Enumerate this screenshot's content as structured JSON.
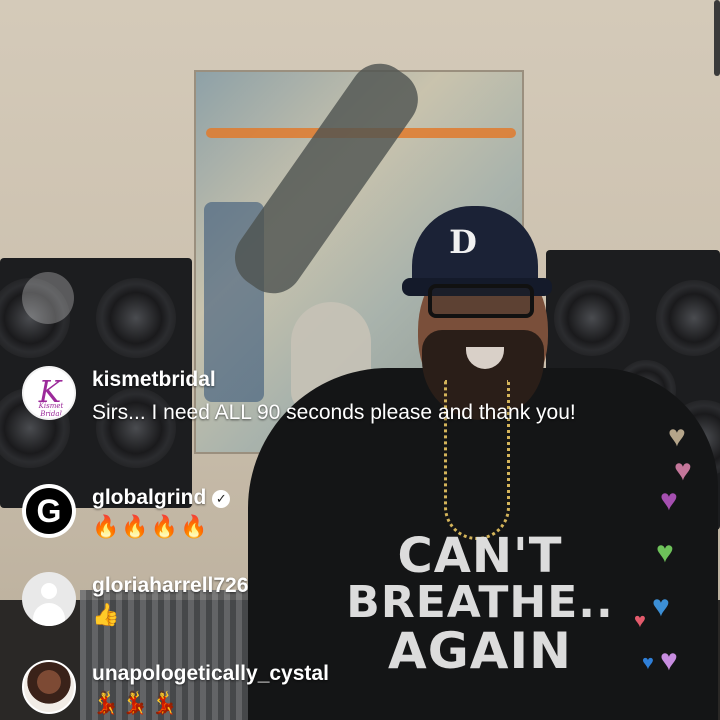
{
  "live": {
    "comments": [
      {
        "username": "kismetbridal",
        "text": "Sirs... I need ALL 90 seconds please and thank you!",
        "avatar_icon": "kismet-bridal-logo",
        "avatar_mark": "K",
        "avatar_sub": "Kismet Bridal"
      },
      {
        "username": "globalgrind",
        "verified": true,
        "verified_glyph": "✓",
        "text": "🔥🔥🔥🔥",
        "avatar_icon": "globalgrind-logo",
        "avatar_mark": "G"
      },
      {
        "username": "gloriaharrell726",
        "text": "👍",
        "avatar_icon": "default-user-icon"
      },
      {
        "username": "unapologetically_cystal",
        "text": "💃💃💃",
        "avatar_icon": "profile-photo"
      }
    ],
    "reactions": {
      "heart_colors": [
        "#b5a58a",
        "#c4769a",
        "#a54fb0",
        "#6ec25a",
        "#3c8fd6",
        "#e35b6c",
        "#c88de0",
        "#2f7fd8"
      ],
      "heart_glyph": "♥"
    }
  },
  "video": {
    "shirt_text": [
      "CAN'T",
      "BREATHE..",
      "AGAIN"
    ],
    "cap_logo": "D"
  }
}
